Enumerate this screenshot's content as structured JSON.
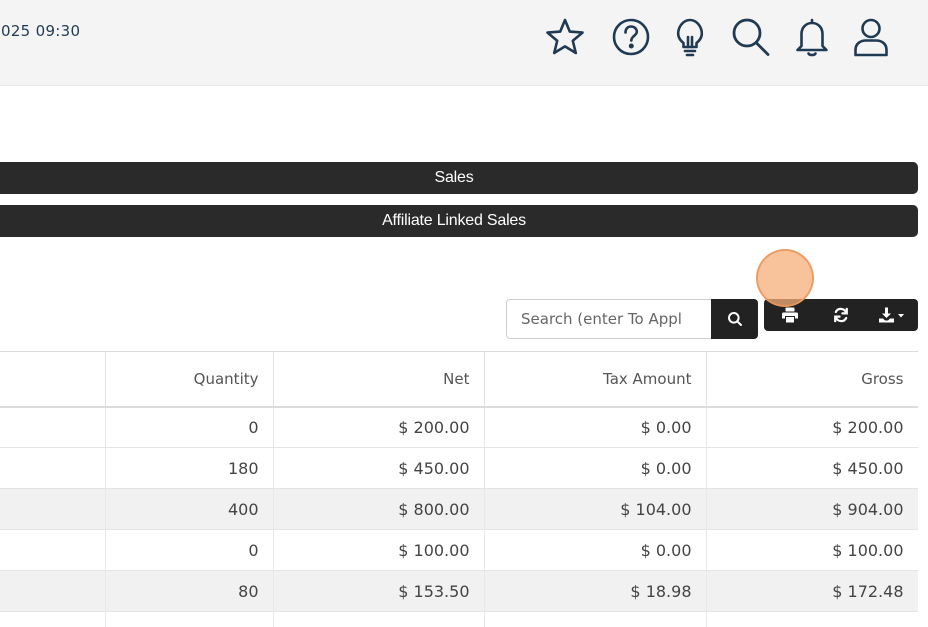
{
  "header": {
    "datetime": "025 09:30",
    "icons": [
      "star-icon",
      "help-icon",
      "lightbulb-icon",
      "search-icon",
      "bell-icon",
      "user-icon"
    ]
  },
  "sections": {
    "sales": "Sales",
    "affiliate": "Affiliate Linked Sales"
  },
  "toolbar": {
    "search_placeholder": "Search (enter To Appl",
    "buttons": [
      "print-icon",
      "refresh-icon",
      "download-icon"
    ]
  },
  "table": {
    "columns": [
      "",
      "Quantity",
      "Net",
      "Tax Amount",
      "Gross"
    ],
    "rows": [
      {
        "quantity": "0",
        "net": "$ 200.00",
        "tax": "$ 0.00",
        "gross": "$ 200.00"
      },
      {
        "quantity": "180",
        "net": "$ 450.00",
        "tax": "$ 0.00",
        "gross": "$ 450.00"
      },
      {
        "quantity": "400",
        "net": "$ 800.00",
        "tax": "$ 104.00",
        "gross": "$ 904.00"
      },
      {
        "quantity": "0",
        "net": "$ 100.00",
        "tax": "$ 0.00",
        "gross": "$ 100.00"
      },
      {
        "quantity": "80",
        "net": "$ 153.50",
        "tax": "$ 18.98",
        "gross": "$ 172.48"
      }
    ]
  },
  "colors": {
    "dark": "#2a2a2a",
    "header_bg": "#f4f4f4",
    "icon_stroke": "#1f3a52",
    "highlight": "#f5af78"
  }
}
